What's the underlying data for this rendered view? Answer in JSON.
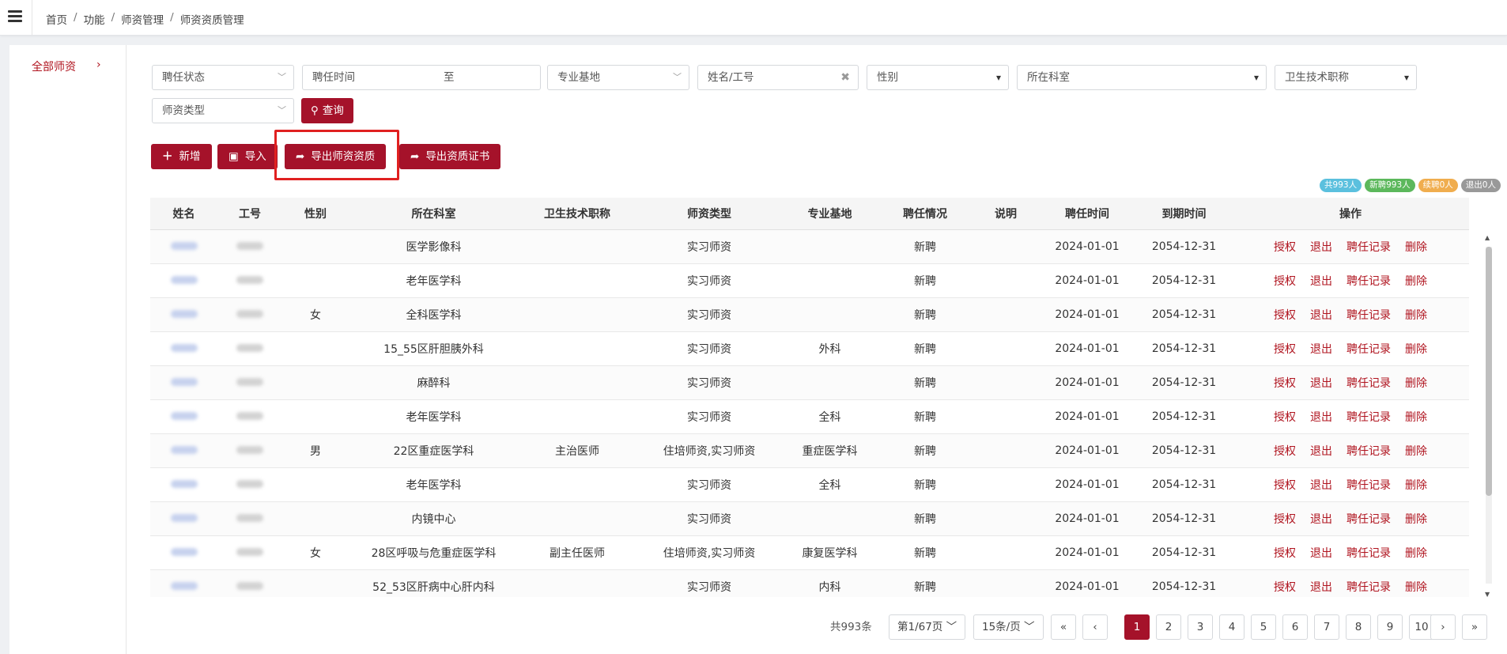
{
  "breadcrumb": [
    "首页",
    "功能",
    "师资管理",
    "师资资质管理"
  ],
  "sidebar": {
    "item": "全部师资",
    "arrow": "›"
  },
  "filters": {
    "status": "聘任状态",
    "hire_time": "聘任时间",
    "hire_to": "至",
    "base": "专业基地",
    "name_id": "姓名/工号",
    "gender": "性别",
    "dept": "所在科室",
    "title": "卫生技术职称",
    "type": "师资类型",
    "query": "查询"
  },
  "toolbar": {
    "add": "新增",
    "import": "导入",
    "export_qual": "导出师资资质",
    "export_cert": "导出资质证书"
  },
  "badges": [
    {
      "text": "共993人",
      "color": "#5bc0de"
    },
    {
      "text": "新聘993人",
      "color": "#5cb85c"
    },
    {
      "text": "续聘0人",
      "color": "#f0ad4e"
    },
    {
      "text": "退出0人",
      "color": "#999999"
    }
  ],
  "table": {
    "columns": [
      "姓名",
      "工号",
      "性别",
      "所在科室",
      "卫生技术职称",
      "师资类型",
      "专业基地",
      "聘任情况",
      "说明",
      "聘任时间",
      "到期时间",
      "操作"
    ],
    "actions": [
      "授权",
      "退出",
      "聘任记录",
      "删除"
    ],
    "rows": [
      {
        "gender": "",
        "dept": "医学影像科",
        "title": "",
        "type": "实习师资",
        "base": "",
        "status": "新聘",
        "note": "",
        "start": "2024-01-01",
        "end": "2054-12-31"
      },
      {
        "gender": "",
        "dept": "老年医学科",
        "title": "",
        "type": "实习师资",
        "base": "",
        "status": "新聘",
        "note": "",
        "start": "2024-01-01",
        "end": "2054-12-31"
      },
      {
        "gender": "女",
        "dept": "全科医学科",
        "title": "",
        "type": "实习师资",
        "base": "",
        "status": "新聘",
        "note": "",
        "start": "2024-01-01",
        "end": "2054-12-31"
      },
      {
        "gender": "",
        "dept": "15_55区肝胆胰外科",
        "title": "",
        "type": "实习师资",
        "base": "外科",
        "status": "新聘",
        "note": "",
        "start": "2024-01-01",
        "end": "2054-12-31"
      },
      {
        "gender": "",
        "dept": "麻醉科",
        "title": "",
        "type": "实习师资",
        "base": "",
        "status": "新聘",
        "note": "",
        "start": "2024-01-01",
        "end": "2054-12-31"
      },
      {
        "gender": "",
        "dept": "老年医学科",
        "title": "",
        "type": "实习师资",
        "base": "全科",
        "status": "新聘",
        "note": "",
        "start": "2024-01-01",
        "end": "2054-12-31"
      },
      {
        "gender": "男",
        "dept": "22区重症医学科",
        "title": "主治医师",
        "type": "住培师资,实习师资",
        "base": "重症医学科",
        "status": "新聘",
        "note": "",
        "start": "2024-01-01",
        "end": "2054-12-31"
      },
      {
        "gender": "",
        "dept": "老年医学科",
        "title": "",
        "type": "实习师资",
        "base": "全科",
        "status": "新聘",
        "note": "",
        "start": "2024-01-01",
        "end": "2054-12-31"
      },
      {
        "gender": "",
        "dept": "内镜中心",
        "title": "",
        "type": "实习师资",
        "base": "",
        "status": "新聘",
        "note": "",
        "start": "2024-01-01",
        "end": "2054-12-31"
      },
      {
        "gender": "女",
        "dept": "28区呼吸与危重症医学科",
        "title": "副主任医师",
        "type": "住培师资,实习师资",
        "base": "康复医学科",
        "status": "新聘",
        "note": "",
        "start": "2024-01-01",
        "end": "2054-12-31"
      },
      {
        "gender": "",
        "dept": "52_53区肝病中心肝内科",
        "title": "",
        "type": "实习师资",
        "base": "内科",
        "status": "新聘",
        "note": "",
        "start": "2024-01-01",
        "end": "2054-12-31"
      }
    ]
  },
  "pagination": {
    "total": "共993条",
    "page_info": "第1/67页",
    "page_size": "15条/页",
    "first": "«",
    "prev": "‹",
    "pages": [
      "1",
      "2",
      "3",
      "4",
      "5",
      "6",
      "7",
      "8",
      "9",
      "10"
    ],
    "next": "›",
    "last": "»"
  }
}
